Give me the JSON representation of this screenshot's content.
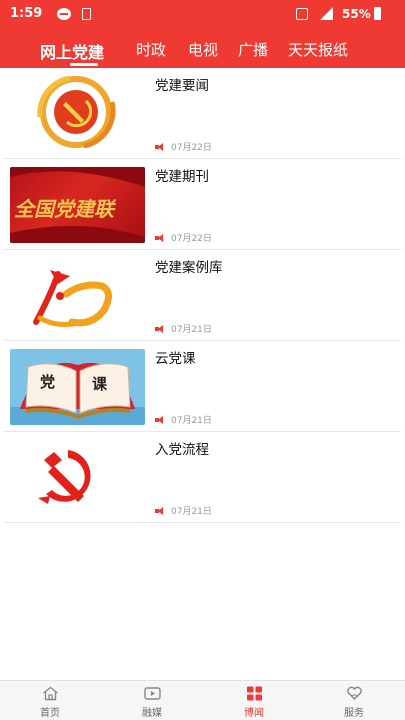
{
  "status_bar": {
    "time": "1:59",
    "battery": "55%"
  },
  "tabs": [
    {
      "label": "网上党建",
      "active": true
    },
    {
      "label": "时政",
      "active": false
    },
    {
      "label": "电视",
      "active": false
    },
    {
      "label": "广播",
      "active": false
    },
    {
      "label": "天天报纸",
      "active": false
    }
  ],
  "items": [
    {
      "title": "党建要闻",
      "date": "07月22日",
      "thumb": "party-emblem-swirl"
    },
    {
      "title": "党建期刊",
      "date": "07月22日",
      "thumb_text": "全国党建联"
    },
    {
      "title": "党建案例库",
      "date": "07月21日",
      "thumb": "party-flag-logo"
    },
    {
      "title": "云党课",
      "date": "07月21日",
      "thumb_text_left": "党",
      "thumb_text_right": "课"
    },
    {
      "title": "入党流程",
      "date": "07月21日",
      "thumb": "hammer-sickle"
    }
  ],
  "bottom_nav": [
    {
      "label": "首页",
      "icon": "home-icon",
      "active": false
    },
    {
      "label": "融媒",
      "icon": "media-icon",
      "active": false
    },
    {
      "label": "博闻",
      "icon": "grid-icon",
      "active": true
    },
    {
      "label": "服务",
      "icon": "heart-hand-icon",
      "active": false
    }
  ],
  "colors": {
    "brand_red": "#ee3a32",
    "date_gray": "#999999"
  }
}
